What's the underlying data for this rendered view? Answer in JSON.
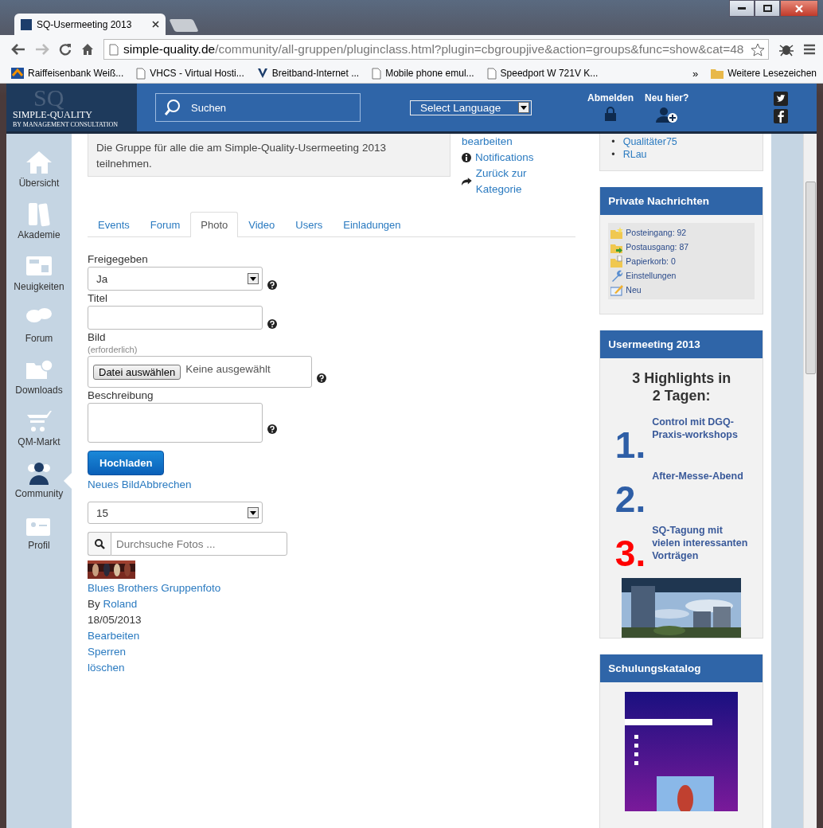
{
  "browser": {
    "tab_title": "SQ-Usermeeting 2013",
    "url_host": "simple-quality.de",
    "url_path": "/community/all-gruppen/pluginclass.html?plugin=cbgroupjive&action=groups&func=show&cat=48",
    "bookmarks": [
      {
        "label": "Raiffeisenbank Weiß...",
        "kind": "bank"
      },
      {
        "label": "VHCS - Virtual Hosti...",
        "kind": "page"
      },
      {
        "label": "Breitband-Internet ...",
        "kind": "v"
      },
      {
        "label": "Mobile phone emul...",
        "kind": "page"
      },
      {
        "label": "Speedport W 721V K...",
        "kind": "page"
      }
    ],
    "more": "»",
    "other_bookmarks": "Weitere Lesezeichen"
  },
  "header": {
    "logo_mark": "SQ",
    "logo_name": "SIMPLE-QUALITY",
    "logo_sub": "BY MANAGEMENT CONSULTATION",
    "search": "Suchen",
    "language": "Select Language",
    "logout": "Abmelden",
    "register": "Neu hier?"
  },
  "sidebar": {
    "items": [
      {
        "label": "Übersicht",
        "kind": "home",
        "selected": false
      },
      {
        "label": "Akademie",
        "kind": "binders",
        "selected": false
      },
      {
        "label": "Neuigkeiten",
        "kind": "news",
        "selected": false
      },
      {
        "label": "Forum",
        "kind": "chat",
        "selected": false
      },
      {
        "label": "Downloads",
        "kind": "folder",
        "selected": false
      },
      {
        "label": "QM-Markt",
        "kind": "cart",
        "selected": false
      },
      {
        "label": "Community",
        "kind": "people",
        "selected": true
      },
      {
        "label": "Profil",
        "kind": "card",
        "selected": false
      }
    ]
  },
  "group": {
    "description": "Die Gruppe für alle die am Simple-Quality-Usermeeting 2013 teilnehmen.",
    "actions": [
      {
        "label": "bearbeiten",
        "kind": "none"
      },
      {
        "label": "Notifications",
        "kind": "info"
      },
      {
        "label": "Zurück zur Kategorie",
        "kind": "share"
      }
    ]
  },
  "tabs": [
    {
      "label": "Events",
      "selected": false
    },
    {
      "label": "Forum",
      "selected": false
    },
    {
      "label": "Photo",
      "selected": true
    },
    {
      "label": "Video",
      "selected": false
    },
    {
      "label": "Users",
      "selected": false
    },
    {
      "label": "Einladungen",
      "selected": false
    }
  ],
  "form": {
    "fields": [
      {
        "label": "Freigegeben",
        "kind": "select",
        "value": "Ja"
      },
      {
        "label": "Titel",
        "kind": "text"
      },
      {
        "label": "Bild",
        "note": "(erforderlich)",
        "kind": "file",
        "button": "Datei auswählen",
        "value": "Keine ausgewählt"
      },
      {
        "label": "Beschreibung",
        "kind": "textarea"
      }
    ],
    "submit": "Hochladen",
    "links": [
      "Neues Bild",
      "Abbrechen"
    ]
  },
  "gallery": {
    "per_page": "15",
    "search_placeholder": "Durchsuche Fotos ...",
    "photos": [
      {
        "title": "Blues Brothers Gruppenfoto",
        "by": "By",
        "author": "Roland",
        "date": "18/05/2013",
        "actions": [
          "Bearbeiten",
          "Sperren",
          "löschen"
        ]
      }
    ]
  },
  "members": {
    "marker": "•",
    "names": [
      "Qualitäter75",
      "RLau"
    ]
  },
  "messages": {
    "title": "Private Nachrichten",
    "items": [
      {
        "label": "Posteingang: 92",
        "kind": "inbox"
      },
      {
        "label": "Postausgang: 87",
        "kind": "outbox"
      },
      {
        "label": "Papierkorb: 0",
        "kind": "trash"
      },
      {
        "label": "Einstellungen",
        "kind": "wrench"
      },
      {
        "label": "Neu",
        "kind": "new"
      }
    ]
  },
  "usermeeting": {
    "title": "Usermeeting 2013",
    "headline": "3 Highlights in 2 Tagen:",
    "highlights": [
      {
        "number": "1.",
        "text": "Control mit DGQ-Praxis-workshops",
        "color": "#2e5ea6"
      },
      {
        "number": "2.",
        "text": "After-Messe-Abend",
        "color": "#2e5ea6"
      },
      {
        "number": "3.",
        "text": "SQ-Tagung mit vielen interessanten Vorträgen",
        "color": "#ff0000"
      }
    ]
  },
  "catalog": {
    "title": "Schulungskatalog"
  }
}
